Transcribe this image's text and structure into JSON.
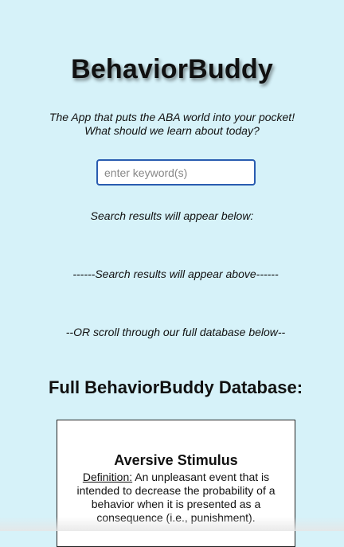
{
  "app": {
    "title": "BehaviorBuddy",
    "tagline_line1": "The App that puts the ABA world into your pocket!",
    "tagline_line2": "What should we learn about today?"
  },
  "search": {
    "placeholder": "enter keyword(s)",
    "value": "",
    "results_label": "Search results will appear below:",
    "results_above_label": "------Search results will appear above------"
  },
  "database": {
    "scroll_hint": "--OR scroll through our full database below--",
    "title": "Full BehaviorBuddy Database:",
    "entries": [
      {
        "term": "Aversive Stimulus",
        "definition_label": "Definition:",
        "definition": " An unpleasant event that is intended to decrease the probability of a behavior when it is presented as a consequence (i.e., punishment)."
      }
    ]
  }
}
